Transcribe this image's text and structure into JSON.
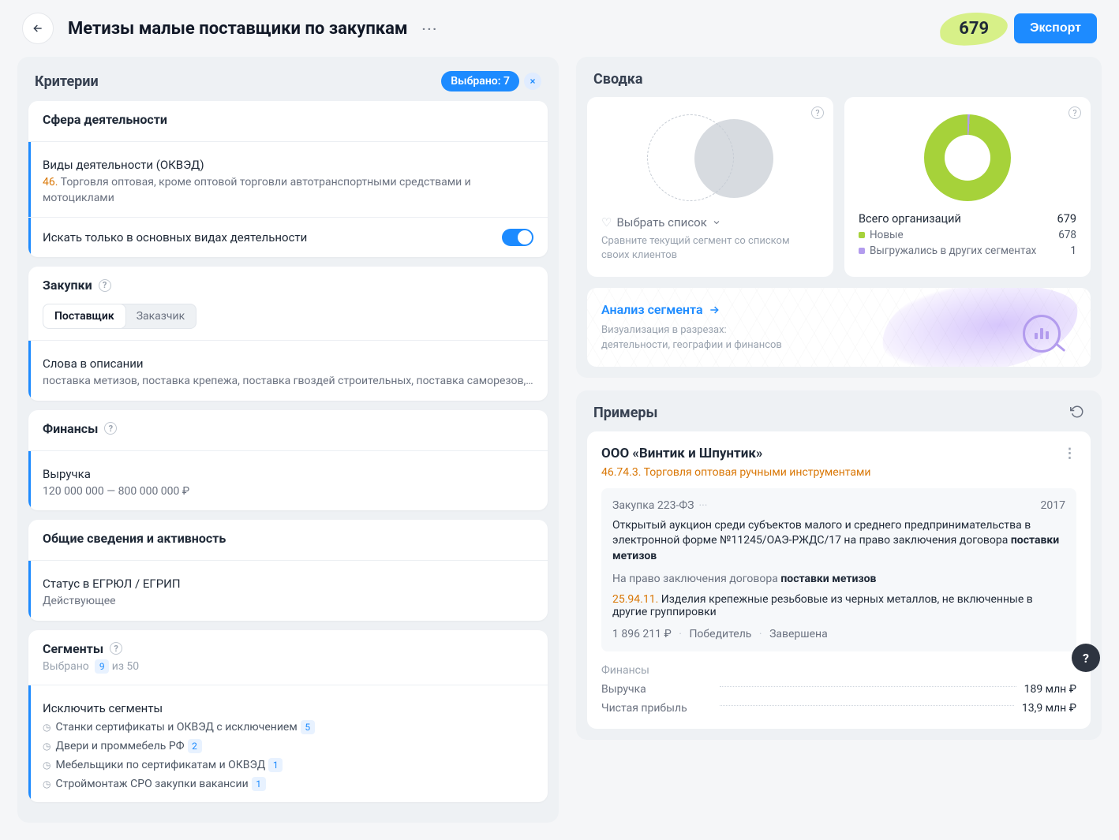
{
  "header": {
    "title": "Метизы малые поставщики по закупкам",
    "count": "679",
    "export_label": "Экспорт"
  },
  "criteria": {
    "heading": "Критерии",
    "selected_pill": "Выбрано: 7",
    "activity": {
      "group_title": "Сфера деятельности",
      "okved_label": "Виды деятельности (ОКВЭД)",
      "okved_code": "46.",
      "okved_text": "Торговля оптовая, кроме оптовой торговли автотранспортными средствами и мотоциклами",
      "only_main_label": "Искать только в основных видах деятельности"
    },
    "purchases": {
      "group_title": "Закупки",
      "tab_supplier": "Поставщик",
      "tab_customer": "Заказчик",
      "words_label": "Слова в описании",
      "words_value": "поставка метизов, поставка крепежа, поставка гвоздей строительных, поставка саморезов, поставка г..."
    },
    "finance": {
      "group_title": "Финансы",
      "revenue_label": "Выручка",
      "revenue_value": "120 000 000 — 800 000 000 ₽"
    },
    "general": {
      "group_title": "Общие сведения и активность",
      "status_label": "Статус в ЕГРЮЛ / ЕГРИП",
      "status_value": "Действующее"
    },
    "segments": {
      "group_title": "Сегменты",
      "selected_prefix": "Выбрано",
      "selected_count": "9",
      "selected_suffix": "из 50",
      "exclude_label": "Исключить сегменты",
      "items": [
        {
          "name": "Станки сертификаты и ОКВЭД с исключением",
          "count": "5"
        },
        {
          "name": "Двери и проммебель РФ",
          "count": "2"
        },
        {
          "name": "Мебельщики по сертификатам и ОКВЭД",
          "count": "1"
        },
        {
          "name": "Строймонтаж СРО закупки вакансии",
          "count": "1"
        }
      ]
    }
  },
  "summary": {
    "heading": "Сводка",
    "select_list": "Выбрать список",
    "compare_hint": "Сравните текущий сегмент со списком своих клиентов",
    "total_orgs_label": "Всего организаций",
    "total_orgs_value": "679",
    "new_label": "Новые",
    "new_value": "678",
    "exported_label": "Выгружались в других сегментах",
    "exported_value": "1",
    "analysis_link": "Анализ сегмента",
    "analysis_sub1": "Визуализация в разрезах:",
    "analysis_sub2": "деятельности, географии и финансов"
  },
  "examples": {
    "heading": "Примеры",
    "company": "ООО «Винтик и Шпунтик»",
    "okved": "46.74.3. Торговля оптовая ручными инструментами",
    "purchase_tag": "Закупка 223-ФЗ",
    "year": "2017",
    "desc_part1": "Открытый аукцион среди субъектов малого и среднего предпринимательства в электронной форме №11245/ОАЭ-РЖДС/17 на право заключения договора ",
    "desc_bold1": "поставки метизов",
    "right_part1": "На право заключения договора ",
    "right_bold": "поставки метизов",
    "okpd_code": "25.94.11.",
    "okpd_text": " Изделия крепежные резьбовые из черных металлов, не включенные в другие группировки",
    "amount": "1 896 211 ₽",
    "status1": "Победитель",
    "status2": "Завершена",
    "fin_heading": "Финансы",
    "fin_revenue_label": "Выручка",
    "fin_revenue_value": "189 млн ₽",
    "fin_profit_label": "Чистая прибыль",
    "fin_profit_value": "13,9 млн ₽"
  },
  "chart_data": {
    "type": "pie",
    "title": "Всего организаций",
    "total": 679,
    "series": [
      {
        "name": "Новые",
        "value": 678,
        "color": "#a6d23a"
      },
      {
        "name": "Выгружались в других сегментах",
        "value": 1,
        "color": "#b39cee"
      }
    ]
  }
}
